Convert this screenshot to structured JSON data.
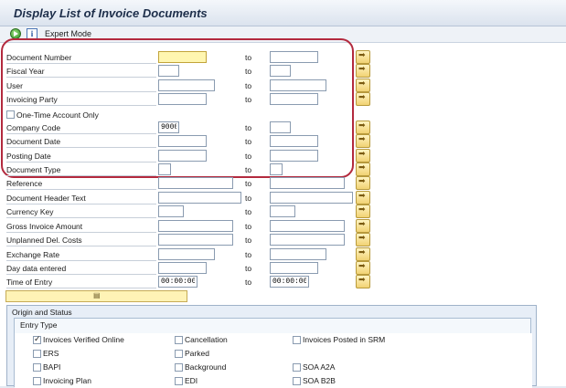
{
  "title": "Display List of Invoice Documents",
  "toolbar": {
    "expert_mode": "Expert Mode"
  },
  "to_label": "to",
  "fields": [
    {
      "label": "Document Number",
      "from": "",
      "to": ""
    },
    {
      "label": "Fiscal Year",
      "from": "",
      "to": ""
    },
    {
      "label": "User",
      "from": "",
      "to": ""
    },
    {
      "label": "Invoicing Party",
      "from": "",
      "to": ""
    },
    {
      "label": "One-Time Account Only"
    },
    {
      "label": "Company Code",
      "from": "9000",
      "to": ""
    },
    {
      "label": "Document Date",
      "from": "",
      "to": ""
    },
    {
      "label": "Posting Date",
      "from": "",
      "to": ""
    },
    {
      "label": "Document Type",
      "from": "",
      "to": ""
    },
    {
      "label": "Reference",
      "from": "",
      "to": ""
    },
    {
      "label": "Document Header Text",
      "from": "",
      "to": ""
    },
    {
      "label": "Currency Key",
      "from": "",
      "to": ""
    },
    {
      "label": "Gross Invoice Amount",
      "from": "",
      "to": ""
    },
    {
      "label": "Unplanned Del. Costs",
      "from": "",
      "to": ""
    },
    {
      "label": "Exchange Rate",
      "from": "",
      "to": ""
    },
    {
      "label": "Day data entered",
      "from": "",
      "to": ""
    },
    {
      "label": "Time of Entry",
      "from": "00:00:00",
      "to": "00:00:00"
    }
  ],
  "origin": {
    "title": "Origin and Status",
    "entry_type": {
      "title": "Entry Type",
      "options": [
        {
          "label": "Invoices Verified Online",
          "checked": true
        },
        {
          "label": "Cancellation",
          "checked": false
        },
        {
          "label": "Invoices Posted in SRM",
          "checked": false
        },
        {
          "label": "ERS",
          "checked": false
        },
        {
          "label": "Parked",
          "checked": false
        },
        {
          "label": "BAPI",
          "checked": false
        },
        {
          "label": "Background",
          "checked": false
        },
        {
          "label": "SOA A2A",
          "checked": false
        },
        {
          "label": "Invoicing Plan",
          "checked": false
        },
        {
          "label": "EDI",
          "checked": false
        },
        {
          "label": "SOA B2B",
          "checked": false
        }
      ]
    }
  }
}
